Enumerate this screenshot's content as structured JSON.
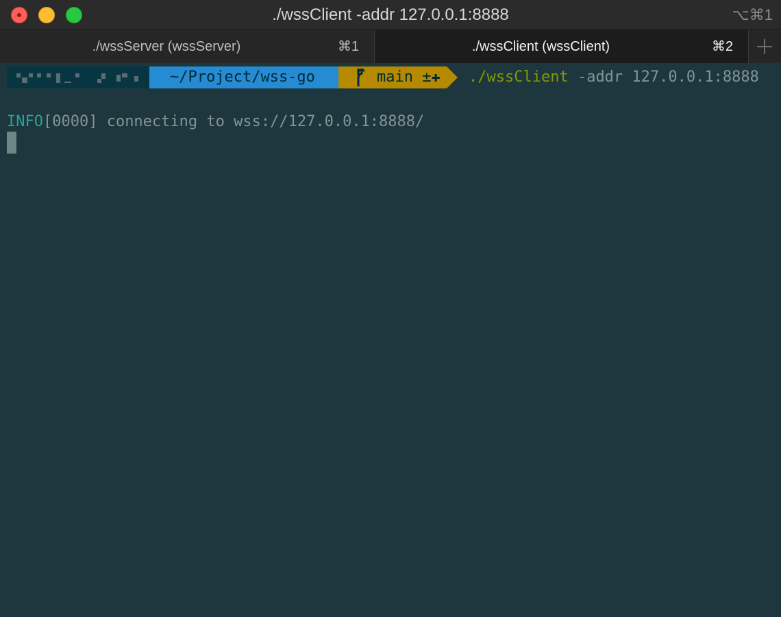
{
  "window": {
    "title": "./wssClient -addr 127.0.0.1:8888",
    "shortcut": "⌥⌘1"
  },
  "tabs": [
    {
      "label": "./wssServer (wssServer)",
      "key": "⌘1",
      "active": false
    },
    {
      "label": "./wssClient (wssClient)",
      "key": "⌘2",
      "active": true
    }
  ],
  "prompt": {
    "path": "~/Project/wss-go",
    "branch_icon": "git-branch-icon",
    "branch": "main ±✚",
    "command": "./wssClient",
    "args": " -addr 127.0.0.1:8888"
  },
  "output": {
    "level": "INFO",
    "rest": "[0000] connecting to wss://127.0.0.1:8888/"
  },
  "colors": {
    "background": "#1e373e",
    "path_segment": "#268bd2",
    "git_segment": "#b58900",
    "command": "#859900",
    "info": "#2aa198"
  }
}
